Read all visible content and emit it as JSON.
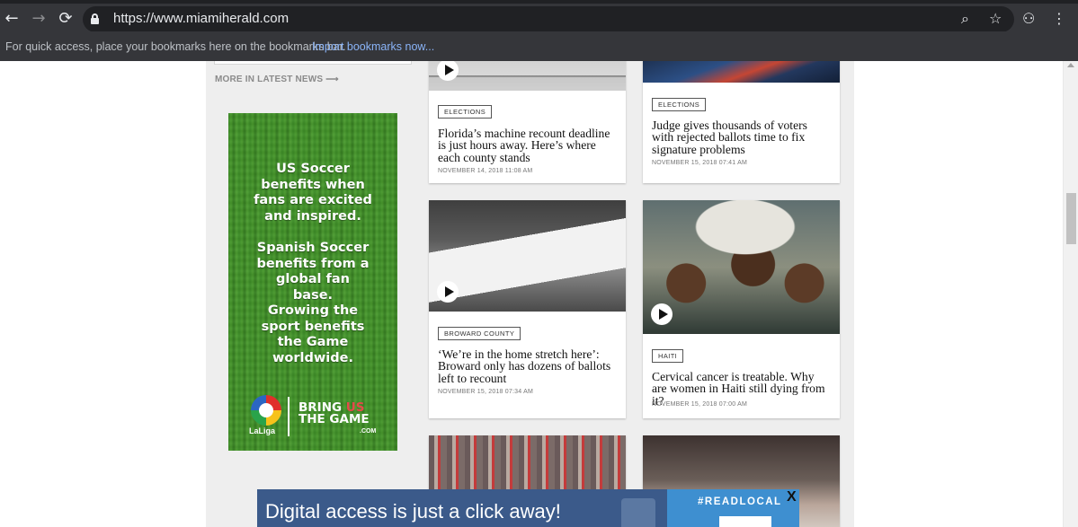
{
  "browser": {
    "url": "https://www.miamiherald.com",
    "bookmarks_bar_text": "For quick access, place your bookmarks here on the bookmarks bar.",
    "bookmarks_bar_link": "Import bookmarks now...",
    "icons": {
      "back": "←",
      "forward": "→",
      "reload": "⟳",
      "zoom": "⌕",
      "star": "☆",
      "incognito": "⚇",
      "menu": "⋮"
    }
  },
  "sidebar": {
    "more_link": "MORE IN LATEST NEWS ⟶",
    "ad": {
      "lines_1": "US Soccer benefits when fans are excited and inspired.",
      "lines_2": "Spanish Soccer benefits from a global fan base.",
      "lines_3": "Growing the sport benefits the Game worldwide.",
      "brand": "LaLiga",
      "slogan_1": "BRING ",
      "slogan_us": "US",
      "slogan_2": "THE GAME",
      "slogan_suffix": ".COM"
    }
  },
  "cards": [
    {
      "tag": "ELECTIONS",
      "headline": "Florida’s machine recount deadline is just hours away. Here’s where each county stands",
      "timestamp": "NOVEMBER 14, 2018 11:08 AM",
      "has_video": true
    },
    {
      "tag": "ELECTIONS",
      "headline": "Judge gives thousands of voters with rejected ballots time to fix signature problems",
      "timestamp": "NOVEMBER 15, 2018 07:41 AM",
      "has_video": false
    },
    {
      "tag": "BROWARD COUNTY",
      "headline": "‘We’re in the home stretch here’: Broward only has dozens of ballots left to recount",
      "timestamp": "NOVEMBER 15, 2018 07:34 AM",
      "has_video": true
    },
    {
      "tag": "HAITI",
      "headline": "Cervical cancer is treatable. Why are women in Haiti still dying from it?",
      "timestamp": "NOVEMBER 15, 2018 07:00 AM",
      "has_video": true
    }
  ],
  "promo": {
    "text": "Digital access is just a click away!",
    "hashtag": "#READLOCAL",
    "close": "X"
  }
}
